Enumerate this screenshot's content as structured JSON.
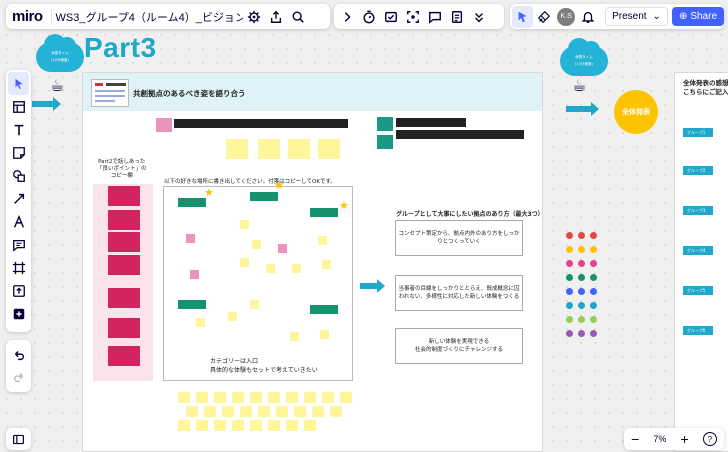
{
  "app": {
    "logo": "miro",
    "board_title": "WS3_グループ4（ルーム4）_ビジョンづく..."
  },
  "toolbar_right": {
    "avatar_initials": "K.S",
    "present_label": "Present",
    "share_label": "Share"
  },
  "zoom": {
    "level": "7%",
    "minus": "−",
    "plus": "+"
  },
  "board": {
    "heading": "Part3",
    "cloud_left": "休憩タイム\n(10分程度)",
    "cloud_right": "休憩タイム\n(10分程度)",
    "frame_title": "共創拠点のあるべき姿を語り合う",
    "circle_label": "全体発表",
    "right_frame_title_1": "全体発表の感想",
    "right_frame_title_2": "こちらにご記入",
    "pink_note": "Part2で話しあった\n「良いポイント」の\nコピー欄",
    "instruction": "以下の好きな場所に書き出してください。付箋はコピーしてOKです。",
    "category_note": "カテゴリーは入口\n具体的な体験もセットで考えていきたい",
    "right_heading": "グループとして大事にしたい拠点のあり方（最大3つ）",
    "boxes": [
      "コンセプト策定から、拠点内外のあり方をしっかりとつくっていく",
      "当事者の目線をしっかりととらえ、既成概念に囚われない、多様性に対応した新しい体験をつくる",
      "新しい体験を実現できる\n社会的制度づくりにチャレンジする"
    ],
    "blue_buttons": [
      "グループ1",
      "グループ2",
      "グループ3",
      "グループ4",
      "グループ5",
      "グループ6"
    ]
  },
  "colors": {
    "accent": "#4262ff",
    "teal": "#1fa8c9",
    "yellow": "#fdc300"
  }
}
